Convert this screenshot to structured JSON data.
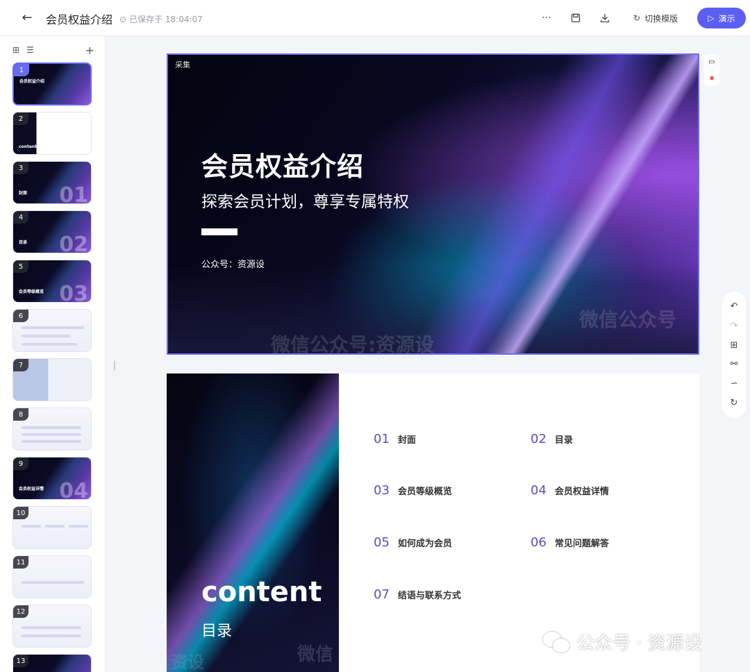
{
  "header": {
    "back_icon": "arrow-left-icon",
    "title": "会员权益介绍",
    "saved_status": "已保存于 18:04:07",
    "more_label": "···",
    "switch_template_label": "切换模版",
    "present_label": "演示"
  },
  "sidebar": {
    "thumbnails": [
      {
        "num": "1",
        "label": "会员权益介绍",
        "big": ""
      },
      {
        "num": "2",
        "label": "content 目录",
        "big": ""
      },
      {
        "num": "3",
        "label": "封面",
        "big": "01"
      },
      {
        "num": "4",
        "label": "目录",
        "big": "02"
      },
      {
        "num": "5",
        "label": "会员等级概览",
        "big": "03"
      },
      {
        "num": "6",
        "label": "",
        "big": ""
      },
      {
        "num": "7",
        "label": "",
        "big": ""
      },
      {
        "num": "8",
        "label": "",
        "big": ""
      },
      {
        "num": "9",
        "label": "会员权益详情",
        "big": "04"
      },
      {
        "num": "10",
        "label": "",
        "big": ""
      },
      {
        "num": "11",
        "label": "",
        "big": ""
      },
      {
        "num": "12",
        "label": "",
        "big": ""
      },
      {
        "num": "13",
        "label": "",
        "big": ""
      }
    ]
  },
  "slide1": {
    "tag": "采集",
    "title": "会员权益介绍",
    "subtitle": "探索会员计划，尊享专属特权",
    "author": "公众号：资源设",
    "watermark_a": "微信公众号:资源设",
    "watermark_b": "微信公众号"
  },
  "slide2": {
    "en_title": "content",
    "cn_title": "目录",
    "watermark": "微信",
    "watermark_left": "资设",
    "items": [
      {
        "num": "01",
        "text": "封面"
      },
      {
        "num": "02",
        "text": "目录"
      },
      {
        "num": "03",
        "text": "会员等级概览"
      },
      {
        "num": "04",
        "text": "会员权益详情"
      },
      {
        "num": "05",
        "text": "如何成为会员"
      },
      {
        "num": "06",
        "text": "常见问题解答"
      },
      {
        "num": "07",
        "text": "结语与联系方式"
      }
    ]
  },
  "watermark_footer": "公众号 · 资源设",
  "collapse_hint": "❘"
}
